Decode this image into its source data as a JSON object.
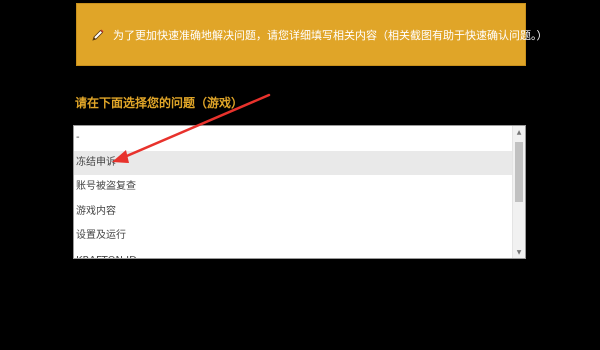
{
  "notice": {
    "text": "为了更加快速准确地解决问题，请您详细填写相关内容（相关截图有助于快速确认问题。）",
    "icon": "pencil-icon"
  },
  "question": {
    "label": "请在下面选择您的问题（游戏）"
  },
  "listbox": {
    "items": [
      {
        "label": "-"
      },
      {
        "label": "冻结申诉",
        "highlighted": true
      },
      {
        "label": "账号被盗复查"
      },
      {
        "label": "游戏内容"
      },
      {
        "label": "设置及运行"
      },
      {
        "label": "KRAFTON ID"
      }
    ],
    "scroll_up_icon": "triangle-up-icon",
    "scroll_down_icon": "triangle-down-icon"
  },
  "annotation": {
    "color": "#e8322c"
  },
  "colors": {
    "background": "#000000",
    "accent": "#e0a528",
    "highlight_row": "#e9e9e9"
  }
}
